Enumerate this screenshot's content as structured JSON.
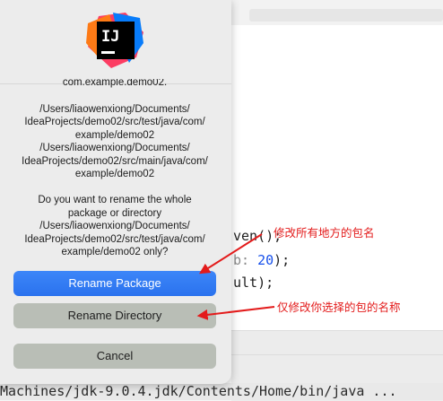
{
  "dialog": {
    "logo": {
      "text": "IJ",
      "icon": "intellij-idea-logo-icon"
    },
    "message": {
      "truncated_line": "com.example.demo02.",
      "paths_test": [
        "/Users/liaowenxiong/Documents/",
        "IdeaProjects/demo02/src/test/java/com/",
        "example/demo02"
      ],
      "paths_main": [
        "/Users/liaowenxiong/Documents/",
        "IdeaProjects/demo02/src/main/java/com/",
        "example/demo02"
      ],
      "question": [
        "Do you want to rename the whole",
        "package or directory",
        "/Users/liaowenxiong/Documents/",
        "IdeaProjects/demo02/src/test/java/com/",
        "example/demo02 only?"
      ]
    },
    "buttons": {
      "rename_package": "Rename Package",
      "rename_directory": "Rename Directory",
      "cancel": "Cancel"
    }
  },
  "annotations": {
    "rename_package_note": "修改所有地方的包名",
    "rename_directory_note": "仅修改你选择的包的名称"
  },
  "code": {
    "line1_text": "ven()",
    "line1_suffix": ";",
    "line2_hint": "b:",
    "line2_num": "20",
    "line2_suffix": ");",
    "line3_text": "ult);"
  },
  "status_bar": {
    "text": "Machines/jdk-9.0.4.jdk/Contents/Home/bin/java ..."
  },
  "colors": {
    "primary_button": "#2f7cf6",
    "annotation": "#e31b1b"
  }
}
